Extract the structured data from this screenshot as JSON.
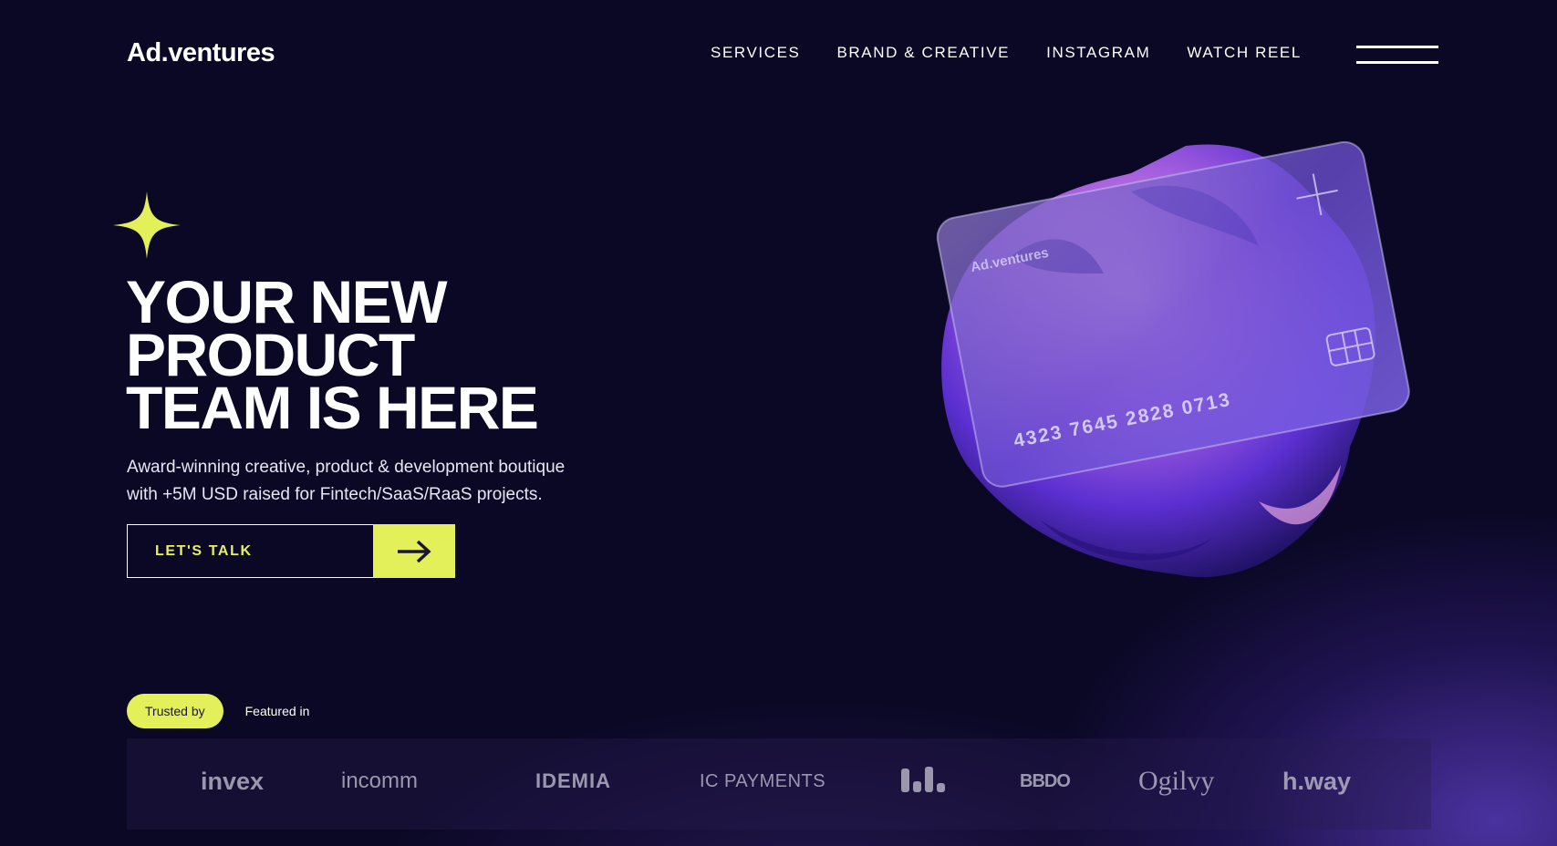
{
  "brand": "Ad.ventures",
  "nav": [
    "SERVICES",
    "BRAND & CREATIVE",
    "INSTAGRAM",
    "WATCH REEL"
  ],
  "hero": {
    "headline": [
      "YOUR NEW",
      "PRODUCT",
      "TEAM IS HERE"
    ],
    "subtitle_lines": [
      "Award-winning creative, product & development boutique",
      "with +5M USD raised for Fintech/SaaS/RaaS projects."
    ],
    "cta": "LET'S TALK"
  },
  "card": {
    "brand": "Ad.ventures",
    "number": "4323 7645 2828 0713"
  },
  "tabs": {
    "trusted": "Trusted by",
    "featured": "Featured in"
  },
  "logos": [
    "invex",
    "incomm",
    "IDEMIA",
    "IC PAYMENTS",
    "BBDO",
    "Ogilvy",
    "h.way"
  ],
  "colors": {
    "accent": "#e4f05a",
    "background": "#0b0826"
  }
}
